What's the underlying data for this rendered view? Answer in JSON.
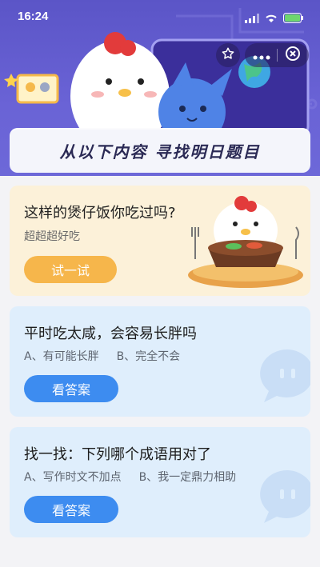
{
  "status": {
    "time": "16:24"
  },
  "header": {
    "banner_text": "从以下内容 寻找明日题目"
  },
  "feature": {
    "title": "这样的煲仔饭你吃过吗?",
    "subtitle": "超超超好吃",
    "button_label": "试一试"
  },
  "questions": [
    {
      "question": "平时吃太咸，会容易长胖吗",
      "option_a": "A、有可能长胖",
      "option_b": "B、完全不会",
      "button_label": "看答案"
    },
    {
      "question": "找一找：下列哪个成语用对了",
      "option_a": "A、写作时文不加点",
      "option_b": "B、我一定鼎力相助",
      "button_label": "看答案"
    }
  ],
  "icons": {
    "star": "star-icon",
    "more": "more-icon",
    "close": "close-icon"
  },
  "colors": {
    "header_bg": "#5b55c7",
    "feature_bg": "#fcf1d9",
    "try_button": "#f6b64b",
    "question_bg": "#dfeefc",
    "answer_button": "#3d8cf0"
  }
}
